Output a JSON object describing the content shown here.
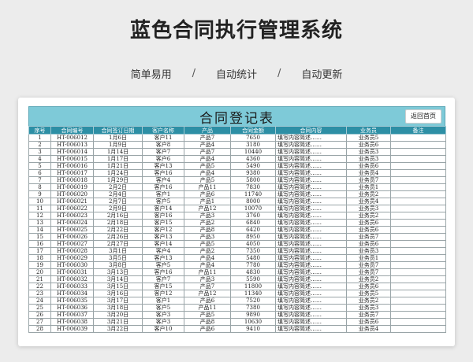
{
  "page": {
    "title": "蓝色合同执行管理系统",
    "features": [
      "简单易用",
      "自动统计",
      "自动更新"
    ],
    "separator": "/"
  },
  "sheet": {
    "title": "合同登记表",
    "back_button": "返回首页",
    "headers": [
      "序号",
      "合同编号",
      "合同签订日期",
      "客户名称",
      "产品",
      "合同金额",
      "合同内容",
      "业务员",
      "备注"
    ],
    "rows": [
      [
        "1",
        "HT-006012",
        "1月6日",
        "客户11",
        "产品7",
        "7650",
        "填写内容简述……",
        "业务员5",
        ""
      ],
      [
        "2",
        "HT-006013",
        "1月9日",
        "客户8",
        "产品4",
        "3180",
        "填写内容简述……",
        "业务员6",
        ""
      ],
      [
        "3",
        "HT-006014",
        "1月14日",
        "客户7",
        "产品7",
        "10440",
        "填写内容简述……",
        "业务员3",
        ""
      ],
      [
        "4",
        "HT-006015",
        "1月17日",
        "客户6",
        "产品4",
        "4360",
        "填写内容简述……",
        "业务员3",
        ""
      ],
      [
        "5",
        "HT-006016",
        "1月21日",
        "客户13",
        "产品5",
        "5490",
        "填写内容简述……",
        "业务员6",
        ""
      ],
      [
        "6",
        "HT-006017",
        "1月24日",
        "客户16",
        "产品4",
        "9380",
        "填写内容简述……",
        "业务员4",
        ""
      ],
      [
        "7",
        "HT-006018",
        "1月29日",
        "客户4",
        "产品5",
        "5800",
        "填写内容简述……",
        "业务员7",
        ""
      ],
      [
        "8",
        "HT-006019",
        "2月2日",
        "客户16",
        "产品11",
        "7830",
        "填写内容简述……",
        "业务员1",
        ""
      ],
      [
        "9",
        "HT-006020",
        "2月4日",
        "客户1",
        "产品6",
        "11740",
        "填写内容简述……",
        "业务员2",
        ""
      ],
      [
        "10",
        "HT-006021",
        "2月7日",
        "客户5",
        "产品1",
        "8000",
        "填写内容简述……",
        "业务员4",
        ""
      ],
      [
        "11",
        "HT-006022",
        "2月9日",
        "客户14",
        "产品12",
        "10070",
        "填写内容简述……",
        "业务员3",
        ""
      ],
      [
        "12",
        "HT-006023",
        "2月16日",
        "客户16",
        "产品3",
        "3760",
        "填写内容简述……",
        "业务员2",
        ""
      ],
      [
        "13",
        "HT-006024",
        "2月18日",
        "客户15",
        "产品2",
        "6840",
        "填写内容简述……",
        "业务员6",
        ""
      ],
      [
        "14",
        "HT-006025",
        "2月22日",
        "客户12",
        "产品8",
        "6420",
        "填写内容简述……",
        "业务员6",
        ""
      ],
      [
        "15",
        "HT-006026",
        "2月26日",
        "客户13",
        "产品3",
        "8950",
        "填写内容简述……",
        "业务员7",
        ""
      ],
      [
        "16",
        "HT-006027",
        "2月27日",
        "客户14",
        "产品5",
        "4050",
        "填写内容简述……",
        "业务员6",
        ""
      ],
      [
        "17",
        "HT-006028",
        "3月1日",
        "客户4",
        "产品2",
        "7350",
        "填写内容简述……",
        "业务员3",
        ""
      ],
      [
        "18",
        "HT-006029",
        "3月5日",
        "客户13",
        "产品4",
        "5480",
        "填写内容简述……",
        "业务员1",
        ""
      ],
      [
        "19",
        "HT-006030",
        "3月8日",
        "客户5",
        "产品4",
        "7780",
        "填写内容简述……",
        "业务员7",
        ""
      ],
      [
        "20",
        "HT-006031",
        "3月13日",
        "客户16",
        "产品11",
        "4830",
        "填写内容简述……",
        "业务员7",
        ""
      ],
      [
        "21",
        "HT-006032",
        "3月14日",
        "客户7",
        "产品3",
        "5590",
        "填写内容简述……",
        "业务员2",
        ""
      ],
      [
        "22",
        "HT-006033",
        "3月15日",
        "客户15",
        "产品7",
        "11800",
        "填写内容简述……",
        "业务员6",
        ""
      ],
      [
        "23",
        "HT-006034",
        "3月16日",
        "客户12",
        "产品12",
        "11340",
        "填写内容简述……",
        "业务员5",
        ""
      ],
      [
        "24",
        "HT-006035",
        "3月17日",
        "客户1",
        "产品6",
        "7520",
        "填写内容简述……",
        "业务员2",
        ""
      ],
      [
        "25",
        "HT-006036",
        "3月18日",
        "客户5",
        "产品11",
        "7380",
        "填写内容简述……",
        "业务员3",
        ""
      ],
      [
        "26",
        "HT-006037",
        "3月20日",
        "客户3",
        "产品5",
        "9890",
        "填写内容简述……",
        "业务员7",
        ""
      ],
      [
        "27",
        "HT-006038",
        "3月21日",
        "客户3",
        "产品8",
        "10630",
        "填写内容简述……",
        "业务员6",
        ""
      ],
      [
        "28",
        "HT-006039",
        "3月22日",
        "客户10",
        "产品6",
        "9410",
        "填写内容简述……",
        "业务员4",
        ""
      ]
    ]
  },
  "colors": {
    "banner": "#7ecad8",
    "header_row": "#2d8fa5"
  }
}
